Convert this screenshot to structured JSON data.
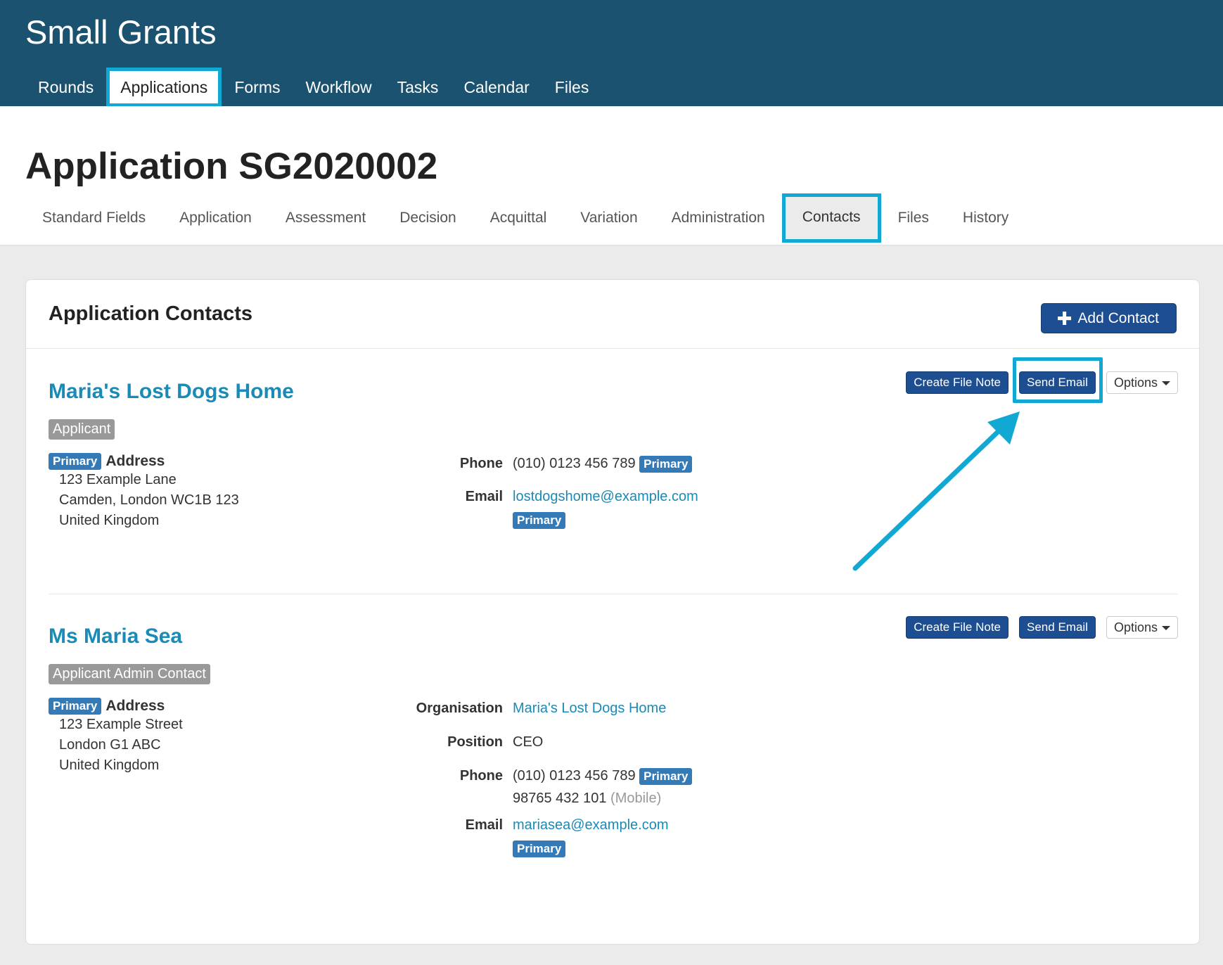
{
  "header": {
    "app_title": "Small Grants",
    "nav": [
      "Rounds",
      "Applications",
      "Forms",
      "Workflow",
      "Tasks",
      "Calendar",
      "Files"
    ],
    "active_nav": "Applications"
  },
  "page": {
    "title": "Application SG2020002",
    "tabs": [
      "Standard Fields",
      "Application",
      "Assessment",
      "Decision",
      "Acquittal",
      "Variation",
      "Administration",
      "Contacts",
      "Files",
      "History"
    ],
    "active_tab": "Contacts"
  },
  "panel": {
    "title": "Application Contacts",
    "add_button": "Add Contact"
  },
  "contact_actions": {
    "create_file_note": "Create File Note",
    "send_email": "Send Email",
    "options": "Options"
  },
  "contacts": [
    {
      "name": "Maria's Lost Dogs Home",
      "role": "Applicant",
      "address_badge": "Primary",
      "address_label": "Address",
      "address_lines": [
        "123 Example Lane",
        "Camden, London WC1B 123",
        "United Kingdom"
      ],
      "phone_label": "Phone",
      "phone": "(010) 0123 456 789",
      "phone_badge": "Primary",
      "email_label": "Email",
      "email": "lostdogshome@example.com",
      "email_badge": "Primary"
    },
    {
      "name": "Ms Maria Sea",
      "role": "Applicant Admin Contact",
      "address_badge": "Primary",
      "address_label": "Address",
      "address_lines": [
        "123 Example Street",
        "London G1 ABC",
        "United Kingdom"
      ],
      "organisation_label": "Organisation",
      "organisation": "Maria's Lost Dogs Home",
      "position_label": "Position",
      "position": "CEO",
      "phone_label": "Phone",
      "phone": "(010) 0123 456 789",
      "phone_badge": "Primary",
      "mobile": "98765 432 101",
      "mobile_note": "(Mobile)",
      "email_label": "Email",
      "email": "mariasea@example.com",
      "email_badge": "Primary"
    }
  ],
  "annotation_color": "#12a8d4",
  "icons": [
    "plus-icon",
    "caret-down-icon"
  ]
}
